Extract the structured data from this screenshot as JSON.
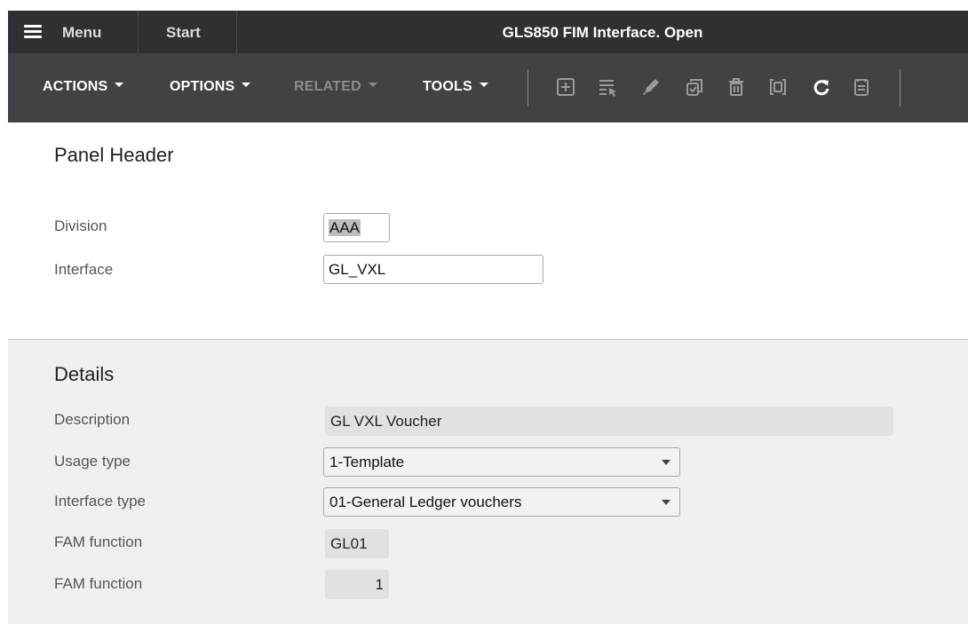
{
  "topbar": {
    "menu_label": "Menu",
    "start_label": "Start",
    "title": "GLS850 FIM Interface. Open"
  },
  "toolbar": {
    "actions_label": "ACTIONS",
    "options_label": "OPTIONS",
    "related_label": "RELATED",
    "tools_label": "TOOLS",
    "icons": [
      "add-icon",
      "select-list-icon",
      "edit-pencil-icon",
      "copy-icon",
      "delete-icon",
      "display-icon",
      "refresh-icon",
      "notes-icon"
    ]
  },
  "panel_header": {
    "title": "Panel Header",
    "division_label": "Division",
    "division_value": "AAA",
    "interface_label": "Interface",
    "interface_value": "GL_VXL"
  },
  "details": {
    "title": "Details",
    "description_label": "Description",
    "description_value": "GL VXL Voucher",
    "usage_type_label": "Usage type",
    "usage_type_value": "1-Template",
    "interface_type_label": "Interface type",
    "interface_type_value": "01-General Ledger vouchers",
    "fam_function_label": "FAM function",
    "fam_function_value": "GL01",
    "fam_function2_label": "FAM function",
    "fam_function2_value": "1"
  },
  "colors": {
    "topbar_bg": "#2f3033",
    "toolbar_bg": "#414245",
    "details_bg": "#efefef"
  }
}
